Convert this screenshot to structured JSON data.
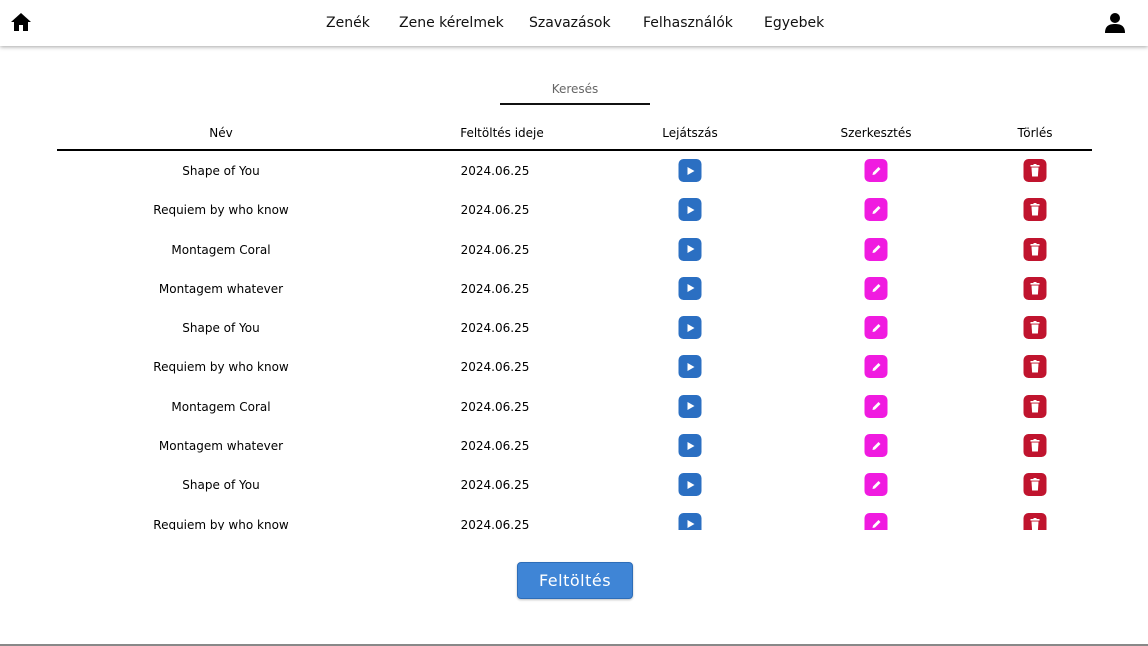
{
  "nav": {
    "home_icon": "home-icon",
    "user_icon": "user-icon",
    "items": [
      {
        "label": "Zenék"
      },
      {
        "label": "Zene kérelmek"
      },
      {
        "label": "Szavazások"
      },
      {
        "label": "Felhasználók"
      },
      {
        "label": "Egyebek"
      }
    ]
  },
  "search": {
    "placeholder": "Keresés",
    "value": ""
  },
  "table": {
    "headers": {
      "name": "Név",
      "upload_date": "Feltöltés ideje",
      "play": "Lejátszás",
      "edit": "Szerkesztés",
      "delete": "Törlés"
    },
    "rows": [
      {
        "name": "Shape of You",
        "date": "2024.06.25"
      },
      {
        "name": "Requiem by who know",
        "date": "2024.06.25"
      },
      {
        "name": "Montagem Coral",
        "date": "2024.06.25"
      },
      {
        "name": "Montagem whatever",
        "date": "2024.06.25"
      },
      {
        "name": "Shape of You",
        "date": "2024.06.25"
      },
      {
        "name": "Requiem by who know",
        "date": "2024.06.25"
      },
      {
        "name": "Montagem Coral",
        "date": "2024.06.25"
      },
      {
        "name": "Montagem whatever",
        "date": "2024.06.25"
      },
      {
        "name": "Shape of You",
        "date": "2024.06.25"
      },
      {
        "name": "Requiem by who know",
        "date": "2024.06.25"
      }
    ],
    "icons": {
      "play": "play-icon",
      "edit": "pencil-icon",
      "delete": "trash-icon"
    }
  },
  "upload_button": {
    "label": "Feltöltés"
  },
  "colors": {
    "play": "#2b6fc2",
    "edit": "#f01be0",
    "delete": "#c0142e",
    "upload": "#3f85d6"
  }
}
